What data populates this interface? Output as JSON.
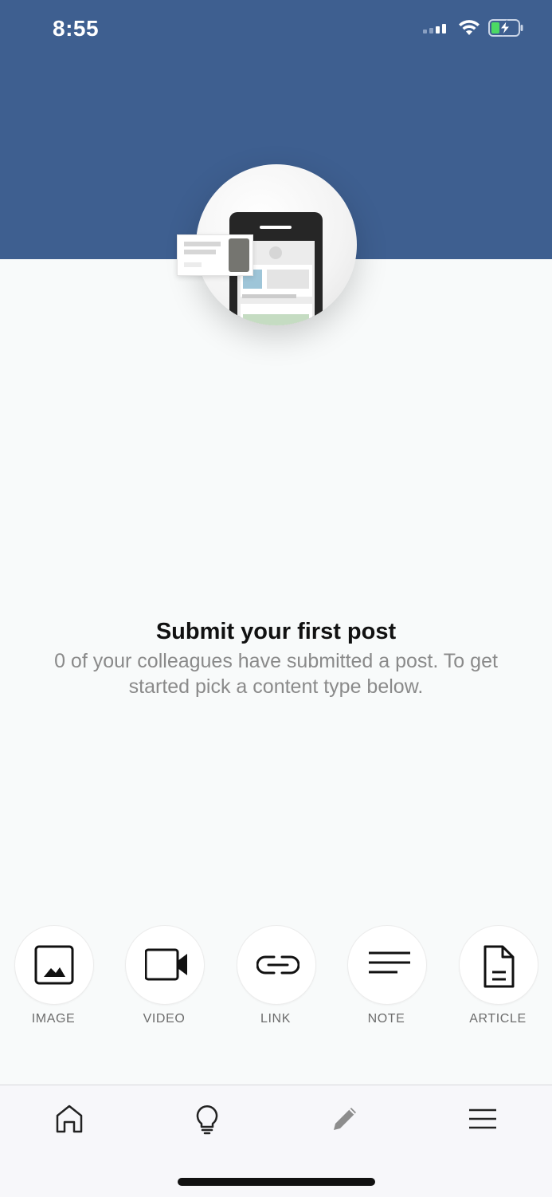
{
  "status_bar": {
    "time": "8:55",
    "icons": [
      "cellular-signal-icon",
      "wifi-icon",
      "battery-charging-icon"
    ],
    "battery_color": "#4cd964"
  },
  "header": {
    "background_color": "#3e5f90"
  },
  "empty_state": {
    "title": "Submit your first post",
    "subtitle": "0 of your colleagues have submitted a post. To get started pick a content type below."
  },
  "content_types": [
    {
      "label": "IMAGE",
      "icon": "image-icon"
    },
    {
      "label": "VIDEO",
      "icon": "video-camera-icon"
    },
    {
      "label": "LINK",
      "icon": "link-icon"
    },
    {
      "label": "NOTE",
      "icon": "note-lines-icon"
    },
    {
      "label": "ARTICLE",
      "icon": "document-icon"
    }
  ],
  "tab_bar": {
    "items": [
      {
        "icon": "home-icon"
      },
      {
        "icon": "lightbulb-icon"
      },
      {
        "icon": "pencil-icon"
      },
      {
        "icon": "menu-icon"
      }
    ]
  }
}
